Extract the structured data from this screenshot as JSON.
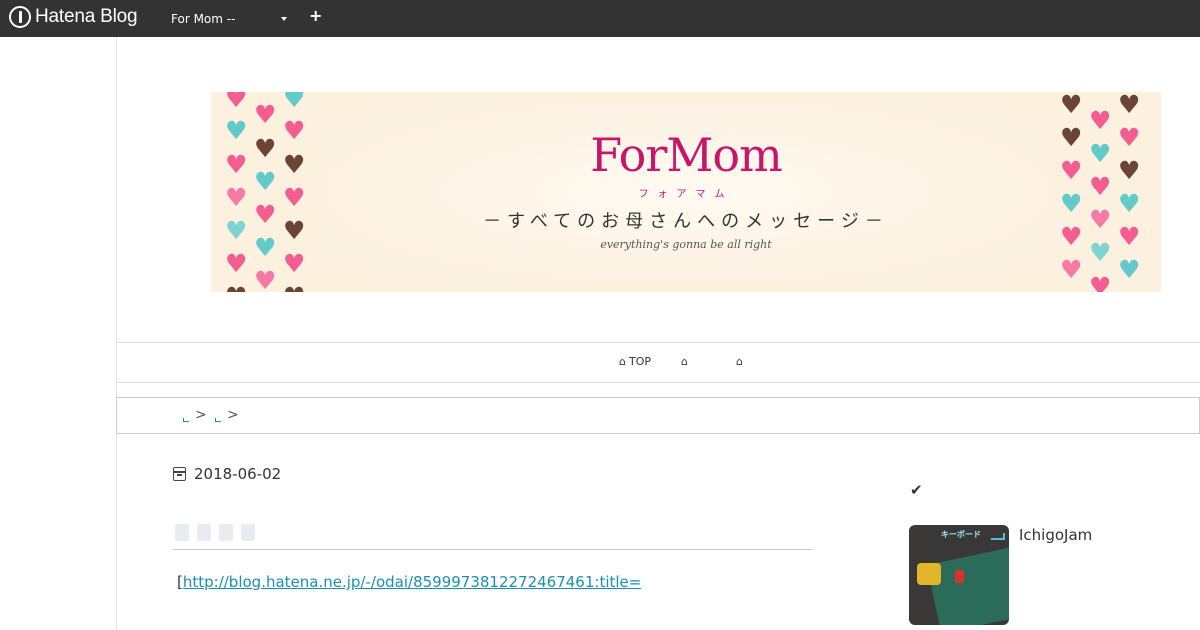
{
  "topbar": {
    "logo_text": "Hatena Blog",
    "blog_select_value": "For Mom --",
    "add_label": "+"
  },
  "banner": {
    "title": "ForMom",
    "kana": "フォアマム",
    "subtitle": "－すべてのお母さんへのメッセージ－",
    "tagline": "everything's gonna be all right",
    "colors": {
      "title": "#c8156a",
      "background": "#fcf0de",
      "pink": "#f45d92",
      "teal": "#62cac9",
      "brown": "#6b4437"
    }
  },
  "global_nav": {
    "items": [
      {
        "icon": "home-icon",
        "label": "TOP"
      },
      {
        "icon": "home-icon",
        "label": ""
      },
      {
        "icon": "home-icon",
        "label": ""
      }
    ]
  },
  "breadcrumb": {
    "separators": [
      ">",
      ">"
    ]
  },
  "entry": {
    "date": "2018-06-02",
    "body_prefix": "[",
    "body_link": "http://blog.hatena.ne.jp/-/odai/8599973812272467461:title="
  },
  "sidebar": {
    "check_icon": "check-icon",
    "item_title": "IchigoJam",
    "thumb_label": "キーボード"
  }
}
